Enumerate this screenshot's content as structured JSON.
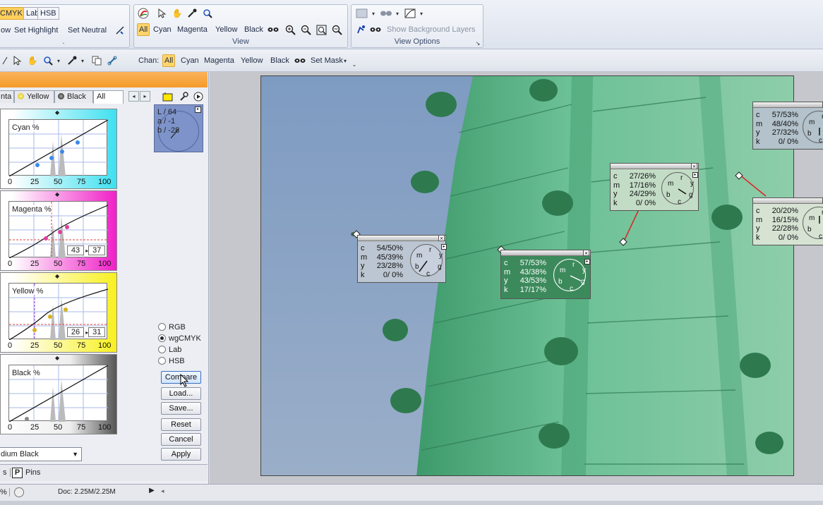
{
  "ribbon": {
    "tabs_left": [
      "CMYK",
      "Lab",
      "HSB"
    ],
    "row2_left": [
      "ow",
      "Set Highlight",
      "Set Neutral"
    ],
    "dot_label": ".",
    "view_group": {
      "label": "View",
      "channels": [
        "All",
        "Cyan",
        "Magenta",
        "Yellow",
        "Black"
      ],
      "selected": "All"
    },
    "view_options_group": {
      "label": "View Options",
      "show_bg_layers": "Show Background Layers"
    }
  },
  "toolbar2": {
    "chan_label": "Chan:",
    "channels": [
      "All",
      "Cyan",
      "Magenta",
      "Yellow",
      "Black"
    ],
    "selected": "All",
    "set_mask": "Set Mask"
  },
  "left_panel": {
    "tabs": [
      "nta",
      "Yellow",
      "Black",
      "All"
    ],
    "active_tab": "All",
    "lab_readout": {
      "l": "L /   64",
      "a": "a /   -1",
      "b": "b /  -28"
    },
    "curves": [
      {
        "title": "Cyan %",
        "color": "#3ee0f0",
        "inout": ""
      },
      {
        "title": "Magenta %",
        "color": "#f020c8",
        "input": "43",
        "output": "37"
      },
      {
        "title": "Yellow %",
        "color": "#f8f020",
        "input": "26",
        "output": "31"
      },
      {
        "title": "Black %",
        "color": "#222222",
        "inout": ""
      }
    ],
    "axis_ticks": [
      "0",
      "25",
      "50",
      "75",
      "100"
    ],
    "modes": [
      "RGB",
      "wgCMYK",
      "Lab",
      "HSB"
    ],
    "selected_mode": "wgCMYK",
    "buttons": {
      "compare": "Compare",
      "load": "Load...",
      "save": "Save...",
      "reset": "Reset",
      "cancel": "Cancel",
      "apply": "Apply"
    },
    "dropdown_value": "dium Black",
    "bottom_tabs": {
      "left": "s",
      "pins": "Pins",
      "pins_badge": "P"
    }
  },
  "readouts": [
    {
      "id": "r1",
      "c": "54/50%",
      "m": "45/39%",
      "y": "23/28%",
      "k": "0/ 0%"
    },
    {
      "id": "r2",
      "c": "57/53%",
      "m": "43/38%",
      "y": "43/53%",
      "k": "17/17%"
    },
    {
      "id": "r3",
      "c": "27/26%",
      "m": "17/16%",
      "y": "24/29%",
      "k": "0/ 0%"
    },
    {
      "id": "r4",
      "c": "57/53%",
      "m": "48/40%",
      "y": "27/32%",
      "k": "0/ 0%"
    },
    {
      "id": "r5",
      "c": "20/20%",
      "m": "16/15%",
      "y": "22/28%",
      "k": "0/ 0%"
    }
  ],
  "dial_letters": [
    "m",
    "r",
    "y",
    "b",
    "c",
    "g"
  ],
  "status": {
    "zoom": "%",
    "doc": "Doc: 2.25M/2.25M"
  },
  "colors": {
    "accent": "#ffd56b",
    "orange": "#f4a23a",
    "photo_sky": "#8aa4c4",
    "photo_copper": "#5fb68a"
  }
}
